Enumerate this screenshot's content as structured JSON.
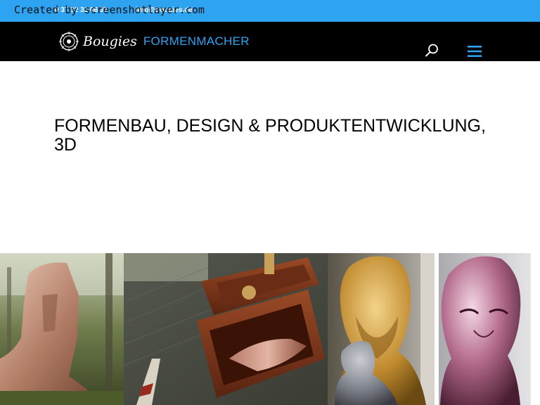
{
  "topbar": {
    "phone": "0 37 32 31 06 37",
    "email": "info@bougies.de"
  },
  "watermark": "Created by screenshotlayer.com",
  "header": {
    "brand": "Bougies",
    "sub": "FORMENMACHER"
  },
  "page": {
    "title": "FORMENBAU, DESIGN & PRODUKTENTWICKLUNG, 3D"
  },
  "collage": {
    "panels": [
      "moai-head-sculpture-image",
      "wooden-box-bullet-image",
      "golden-bust-image",
      "metallic-bust-image"
    ]
  },
  "colors": {
    "accent": "#2ea3f2",
    "header_bg": "#000000",
    "background": "#ffffff"
  }
}
